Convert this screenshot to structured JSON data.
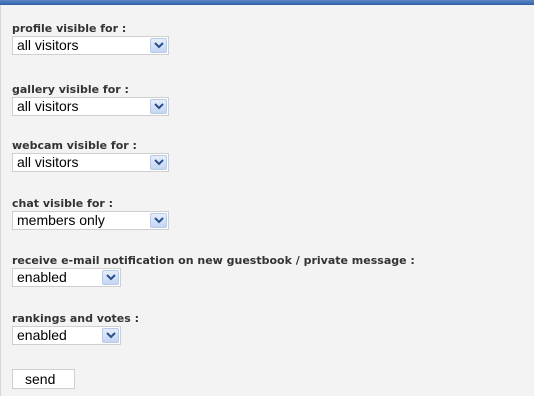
{
  "settings": [
    {
      "label": "profile visible for :",
      "value": "all visitors"
    },
    {
      "label": "gallery visible for :",
      "value": "all visitors"
    },
    {
      "label": "webcam visible for :",
      "value": "all visitors"
    },
    {
      "label": "chat visible for :",
      "value": "members only"
    },
    {
      "label": "receive e-mail notification on new guestbook / private message :",
      "value": "enabled"
    },
    {
      "label": "rankings and votes :",
      "value": "enabled"
    }
  ],
  "send_label": "send",
  "icons": {
    "dropdown": "chevron-down-icon"
  },
  "colors": {
    "top_bar": "#2f5ea8",
    "background": "#f3f3f3",
    "dropdown_button": "#c3d5f2"
  }
}
